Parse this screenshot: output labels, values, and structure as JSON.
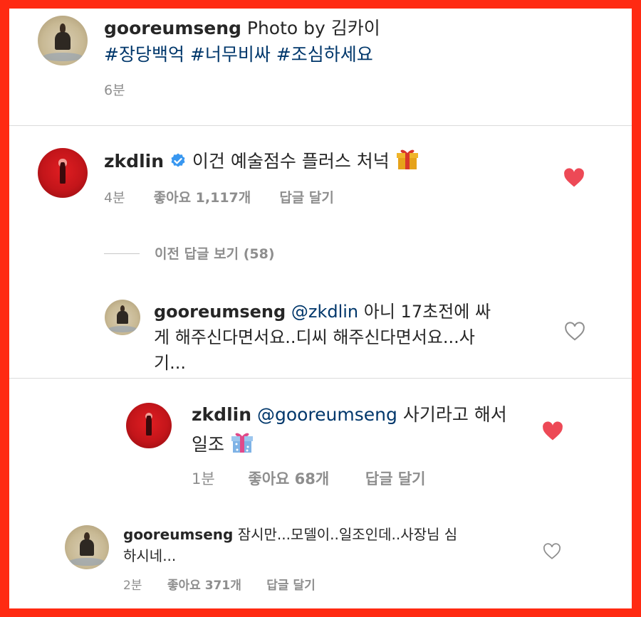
{
  "post": {
    "username": "gooreumseng",
    "caption": "Photo by 김카이",
    "hashtags": "#장당백억 #너무비싸 #조심하세요",
    "time": "6분"
  },
  "comment1": {
    "username": "zkdlin",
    "text": "이건 예술점수 플러스 처넉",
    "time": "4분",
    "likes": "좋아요 1,117개",
    "reply": "답글 달기",
    "view_replies": "이전 답글 보기 (58)"
  },
  "reply1": {
    "username": "gooreumseng",
    "mention": "@zkdlin",
    "line1": "아니 17초전에 싸",
    "line2": "게 해주신다면서요..디씨 해주신다면서요...사",
    "line3": "기..."
  },
  "reply2": {
    "username": "zkdlin",
    "mention": "@gooreumseng",
    "line1": "사기라고 해서",
    "line2": "일조",
    "time": "1분",
    "likes": "좋아요 68개",
    "reply": "답글 달기"
  },
  "reply3": {
    "username": "gooreumseng",
    "line1": "잠시만...모델이..일조인데..사장님 심",
    "line2": "하시네...",
    "time": "2분",
    "likes": "좋아요 371개",
    "reply": "답글 달기"
  },
  "colors": {
    "frame": "#ff2a12",
    "like_red": "#ed4956",
    "link_blue": "#00376b",
    "verified_blue": "#3897f0"
  },
  "icons": [
    "verified-badge-icon",
    "heart-filled-icon",
    "heart-outline-icon",
    "gift-icon"
  ]
}
